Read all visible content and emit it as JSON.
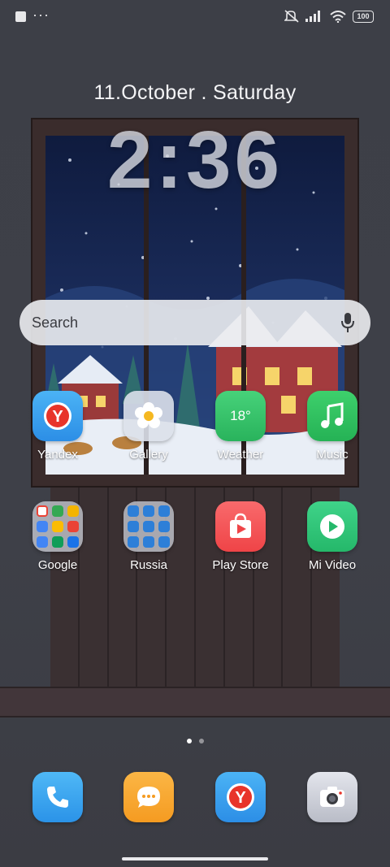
{
  "status_bar": {
    "battery": "100",
    "icons": [
      "notification-square-icon",
      "more-dots-icon",
      "mute-icon",
      "signal-icon",
      "wifi-icon",
      "battery-icon"
    ]
  },
  "lockscreen": {
    "date": "11.October . Saturday",
    "time": "2:36"
  },
  "search": {
    "placeholder": "Search"
  },
  "row1": [
    {
      "label": "Yandex",
      "icon": "yandex-icon"
    },
    {
      "label": "Gallery",
      "icon": "gallery-flower-icon"
    },
    {
      "label": "Weather",
      "icon": "weather-icon",
      "temp": "18°"
    },
    {
      "label": "Music",
      "icon": "music-note-icon"
    }
  ],
  "row2": [
    {
      "label": "Google",
      "icon": "folder-icon"
    },
    {
      "label": "Russia",
      "icon": "folder-icon"
    },
    {
      "label": "Play Store",
      "icon": "play-store-icon"
    },
    {
      "label": "Mi Video",
      "icon": "mi-video-icon"
    }
  ],
  "dock": [
    {
      "icon": "phone-icon"
    },
    {
      "icon": "messages-icon"
    },
    {
      "icon": "yandex-browser-icon"
    },
    {
      "icon": "camera-icon"
    }
  ],
  "pages": {
    "current": 1,
    "total": 2
  },
  "colors": {
    "phone": "#3aa6f0",
    "messages": "#f7a531",
    "yandex": "#e8342a",
    "weather": "#34c16a",
    "music": "#2fbe5d",
    "playstore": "#f04d4f",
    "mivideo": "#2ec27a"
  }
}
